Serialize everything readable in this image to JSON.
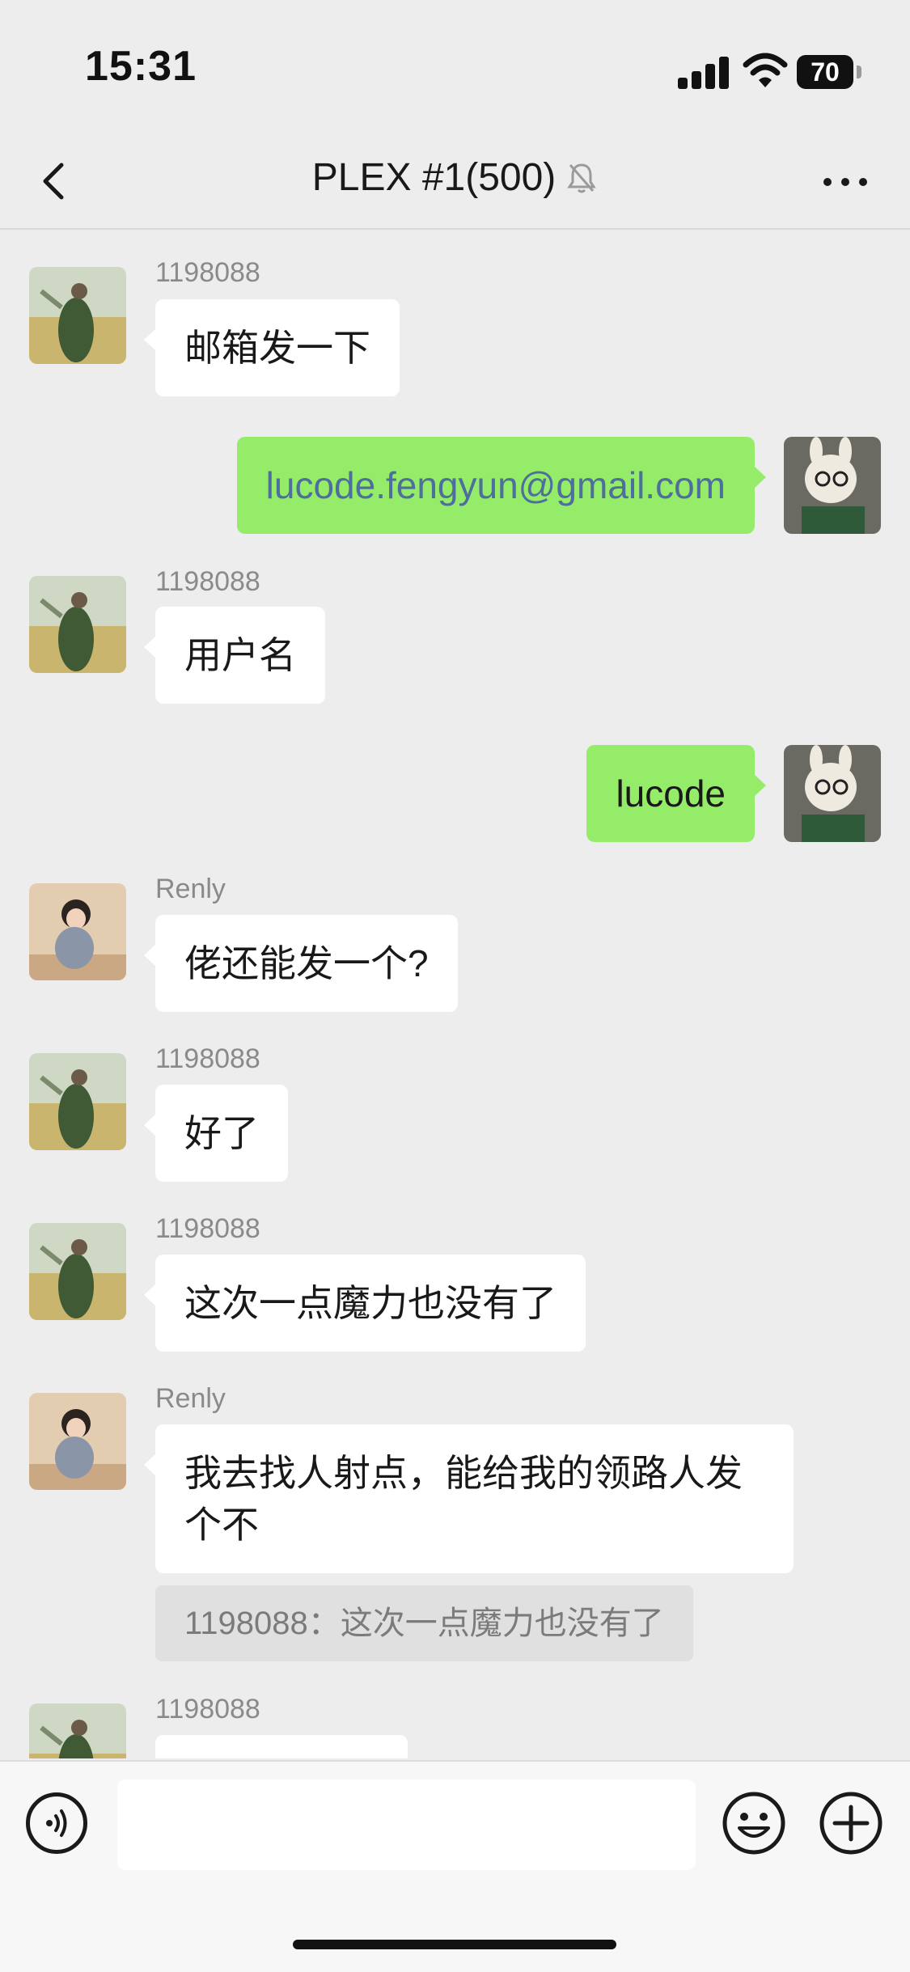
{
  "status_bar": {
    "time": "15:31",
    "battery_percent": "70"
  },
  "header": {
    "title": "PLEX #1(500)",
    "muted": true,
    "icons": {
      "back": "chevron-left-icon",
      "muted": "bell-slash-icon",
      "more": "more-dots-icon"
    }
  },
  "messages": [
    {
      "sender": "1198088",
      "text": "邮箱发一下",
      "side": "left"
    },
    {
      "text": "lucode.fengyun@gmail.com",
      "side": "right"
    },
    {
      "sender": "1198088",
      "text": "用户名",
      "side": "left"
    },
    {
      "text": "lucode",
      "side": "right"
    },
    {
      "sender": "Renly",
      "text": "佬还能发一个?",
      "side": "left"
    },
    {
      "sender": "1198088",
      "text": "好了",
      "side": "left"
    },
    {
      "sender": "1198088",
      "text": "这次一点魔力也没有了",
      "side": "left"
    },
    {
      "sender": "Renly",
      "text": "我去找人射点，能给我的领路人发个不",
      "side": "left",
      "quote": "1198088：这次一点魔力也没有了"
    },
    {
      "sender": "1198088",
      "text": "",
      "side": "left"
    }
  ],
  "input_bar": {
    "placeholder": "",
    "icons": {
      "voice": "voice-icon",
      "emoji": "emoji-icon",
      "plus": "plus-icon"
    }
  },
  "colors": {
    "background": "#ededed",
    "outgoing_bubble": "#95ec69",
    "incoming_bubble": "#ffffff",
    "link": "#4e6e9b"
  }
}
